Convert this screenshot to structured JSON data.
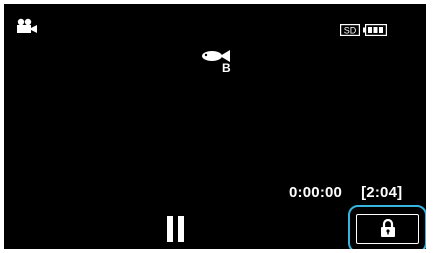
{
  "status_bar": {
    "mode_icon": "video-camera-icon",
    "media_label": "SD",
    "battery_icon": "battery-full-icon"
  },
  "scene": {
    "icon": "fish-icon",
    "sub_label": "B"
  },
  "playback": {
    "elapsed": "0:00:00",
    "remaining": "[2:04]",
    "pause_icon": "pause-icon"
  },
  "lock_button": {
    "icon": "lock-icon",
    "accent_color": "#35b6e0"
  }
}
